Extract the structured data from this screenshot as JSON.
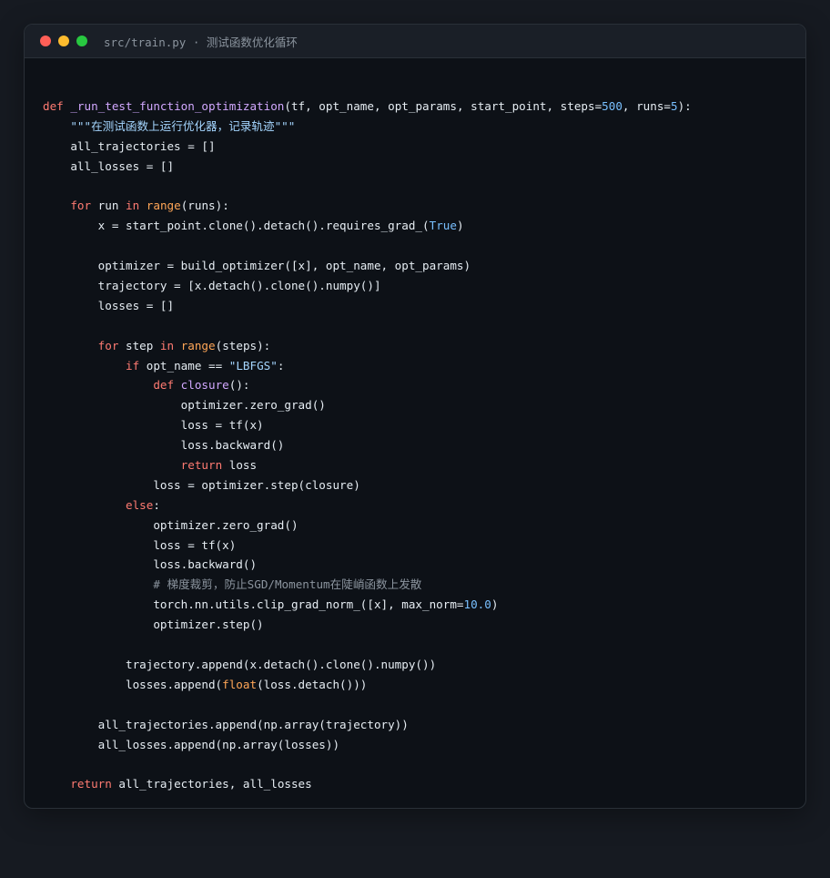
{
  "window": {
    "title": "src/train.py · 测试函数优化循环"
  },
  "colors": {
    "background": "#161a21",
    "editor_bg": "#0d1117",
    "keyword": "#ff7b72",
    "function": "#d2a8ff",
    "number": "#79c0ff",
    "string": "#a5d6ff",
    "builtin": "#ffa657",
    "comment": "#8b949e",
    "text": "#e6edf3"
  },
  "code_lines": [
    [
      [
        "kw",
        "def"
      ],
      [
        "plain",
        " "
      ],
      [
        "fn",
        "_run_test_function_optimization"
      ],
      [
        "plain",
        "(tf, opt_name, opt_params, start_point, steps="
      ],
      [
        "num",
        "500"
      ],
      [
        "plain",
        ", runs="
      ],
      [
        "num",
        "5"
      ],
      [
        "plain",
        "):"
      ]
    ],
    [
      [
        "plain",
        "    "
      ],
      [
        "str",
        "\"\"\"在测试函数上运行优化器，记录轨迹\"\"\""
      ]
    ],
    [
      [
        "plain",
        "    all_trajectories = []"
      ]
    ],
    [
      [
        "plain",
        "    all_losses = []"
      ]
    ],
    [],
    [
      [
        "plain",
        "    "
      ],
      [
        "kw",
        "for"
      ],
      [
        "plain",
        " run "
      ],
      [
        "kw",
        "in"
      ],
      [
        "plain",
        " "
      ],
      [
        "bi",
        "range"
      ],
      [
        "plain",
        "(runs):"
      ]
    ],
    [
      [
        "plain",
        "        x = start_point.clone().detach().requires_grad_("
      ],
      [
        "num",
        "True"
      ],
      [
        "plain",
        ")"
      ]
    ],
    [],
    [
      [
        "plain",
        "        optimizer = build_optimizer([x], opt_name, opt_params)"
      ]
    ],
    [
      [
        "plain",
        "        trajectory = [x.detach().clone().numpy()]"
      ]
    ],
    [
      [
        "plain",
        "        losses = []"
      ]
    ],
    [],
    [
      [
        "plain",
        "        "
      ],
      [
        "kw",
        "for"
      ],
      [
        "plain",
        " step "
      ],
      [
        "kw",
        "in"
      ],
      [
        "plain",
        " "
      ],
      [
        "bi",
        "range"
      ],
      [
        "plain",
        "(steps):"
      ]
    ],
    [
      [
        "plain",
        "            "
      ],
      [
        "kw",
        "if"
      ],
      [
        "plain",
        " opt_name == "
      ],
      [
        "str",
        "\"LBFGS\""
      ],
      [
        "plain",
        ":"
      ]
    ],
    [
      [
        "plain",
        "                "
      ],
      [
        "kw",
        "def"
      ],
      [
        "plain",
        " "
      ],
      [
        "fn",
        "closure"
      ],
      [
        "plain",
        "():"
      ]
    ],
    [
      [
        "plain",
        "                    optimizer.zero_grad()"
      ]
    ],
    [
      [
        "plain",
        "                    loss = tf(x)"
      ]
    ],
    [
      [
        "plain",
        "                    loss.backward()"
      ]
    ],
    [
      [
        "plain",
        "                    "
      ],
      [
        "kw",
        "return"
      ],
      [
        "plain",
        " loss"
      ]
    ],
    [
      [
        "plain",
        "                loss = optimizer.step(closure)"
      ]
    ],
    [
      [
        "plain",
        "            "
      ],
      [
        "kw",
        "else"
      ],
      [
        "plain",
        ":"
      ]
    ],
    [
      [
        "plain",
        "                optimizer.zero_grad()"
      ]
    ],
    [
      [
        "plain",
        "                loss = tf(x)"
      ]
    ],
    [
      [
        "plain",
        "                loss.backward()"
      ]
    ],
    [
      [
        "plain",
        "                "
      ],
      [
        "cm",
        "# 梯度裁剪，防止SGD/Momentum在陡峭函数上发散"
      ]
    ],
    [
      [
        "plain",
        "                torch.nn.utils.clip_grad_norm_([x], max_norm="
      ],
      [
        "num",
        "10.0"
      ],
      [
        "plain",
        ")"
      ]
    ],
    [
      [
        "plain",
        "                optimizer.step()"
      ]
    ],
    [],
    [
      [
        "plain",
        "            trajectory.append(x.detach().clone().numpy())"
      ]
    ],
    [
      [
        "plain",
        "            losses.append("
      ],
      [
        "bi",
        "float"
      ],
      [
        "plain",
        "(loss.detach()))"
      ]
    ],
    [],
    [
      [
        "plain",
        "        all_trajectories.append(np.array(trajectory))"
      ]
    ],
    [
      [
        "plain",
        "        all_losses.append(np.array(losses))"
      ]
    ],
    [],
    [
      [
        "plain",
        "    "
      ],
      [
        "kw",
        "return"
      ],
      [
        "plain",
        " all_trajectories, all_losses"
      ]
    ]
  ]
}
